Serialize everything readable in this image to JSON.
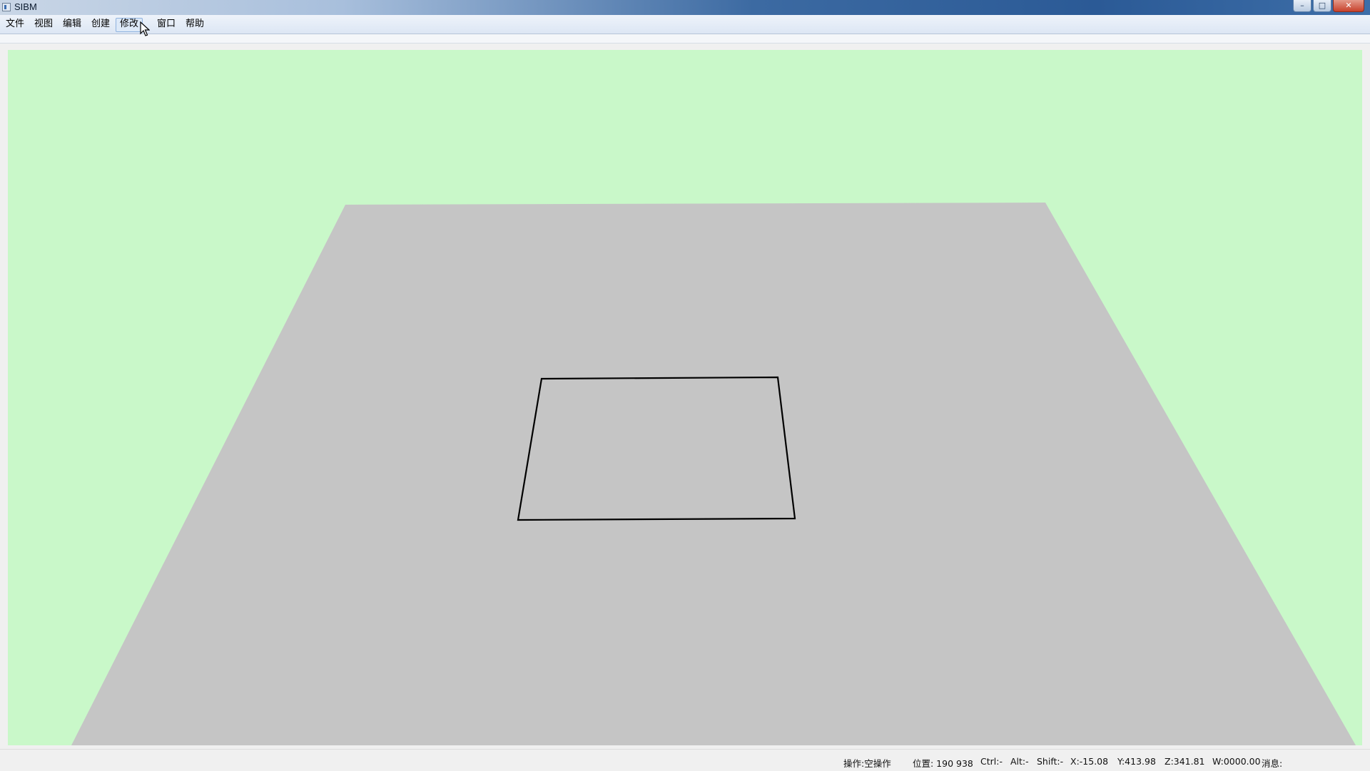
{
  "window": {
    "title": "SIBM",
    "buttons": {
      "minimize": "–",
      "maximize": "□",
      "close": "✕"
    }
  },
  "menu": {
    "items": [
      {
        "id": "file",
        "label": "文件"
      },
      {
        "id": "view",
        "label": "视图"
      },
      {
        "id": "edit",
        "label": "编辑"
      },
      {
        "id": "create",
        "label": "创建"
      },
      {
        "id": "modify",
        "label": "修改"
      },
      {
        "id": "window",
        "label": "窗口"
      },
      {
        "id": "help",
        "label": "帮助"
      }
    ],
    "hovered": "modify"
  },
  "viewport": {
    "background_color": "#c9f8c9",
    "ground_plane_color": "#c5c5c5",
    "outline_color": "#000000"
  },
  "status": {
    "operation": "操作:空操作",
    "position": "位置: 190  938",
    "ctrl": "Ctrl:-",
    "alt": "Alt:-",
    "shift": "Shift:-",
    "x": "X:-15.08",
    "y": "Y:413.98",
    "z": "Z:341.81",
    "w": "W:0000.00",
    "message": "消息:"
  }
}
